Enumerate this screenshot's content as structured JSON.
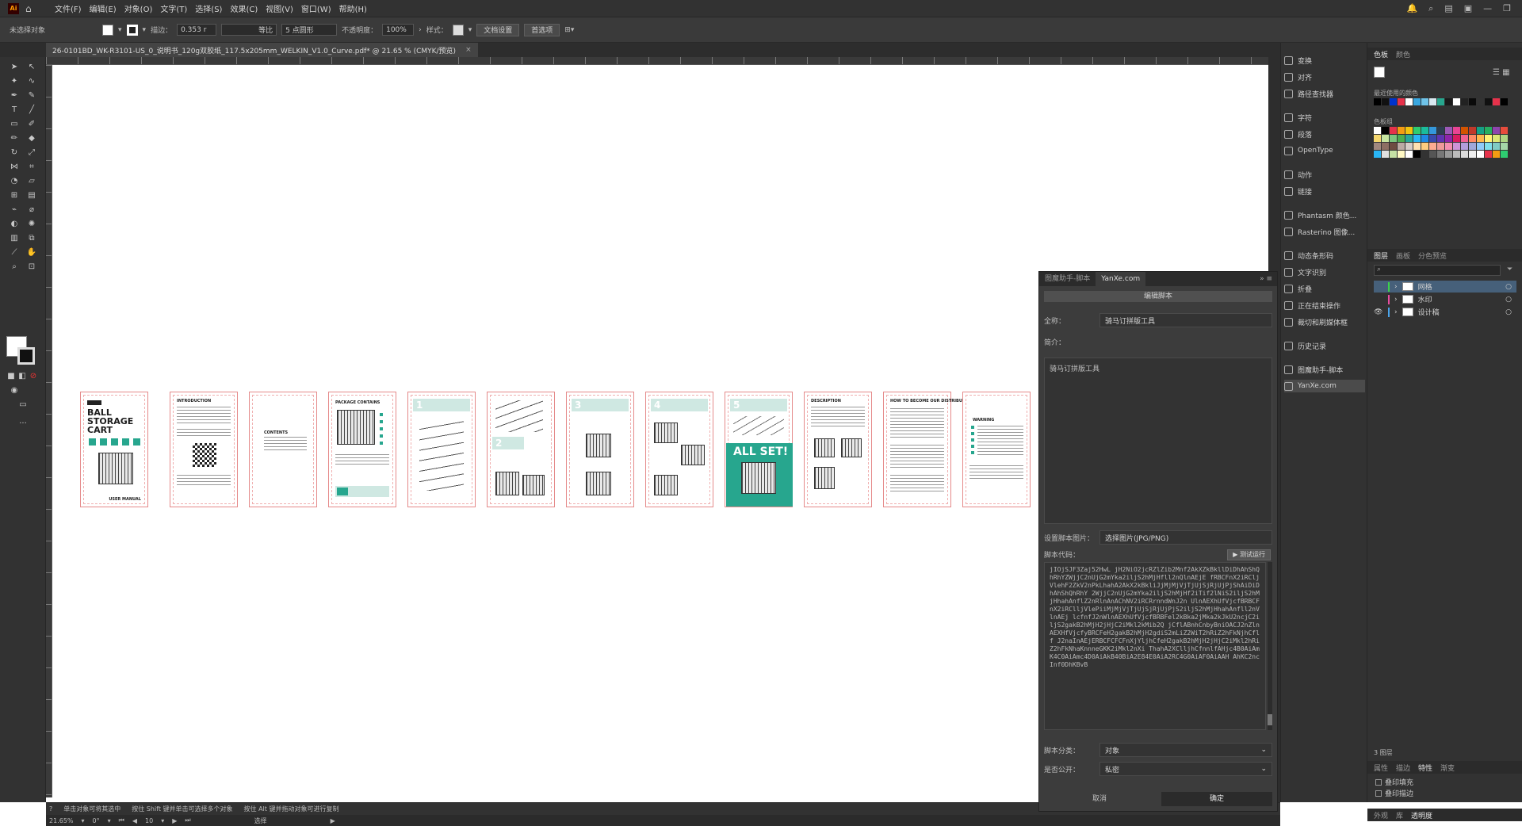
{
  "app": {
    "logo_text": "Ai"
  },
  "menubar": {
    "items": [
      "文件(F)",
      "编辑(E)",
      "对象(O)",
      "文字(T)",
      "选择(S)",
      "效果(C)",
      "视图(V)",
      "窗口(W)",
      "帮助(H)"
    ]
  },
  "control_bar": {
    "no_selection": "未选择对象",
    "stroke_label": "描边：",
    "stroke_value": "0.353 r",
    "stroke_style": "等比",
    "brush": "5 点圆形",
    "opacity_label": "不透明度：",
    "opacity_value": "100%",
    "style_label": "样式：",
    "doc_setup": "文档设置",
    "preferences": "首选项"
  },
  "document_tab": {
    "title": "26-0101BD_WK-R3101-US_0_说明书_120g双胶纸_117.5x205mm_WELKIN_V1.0_Curve.pdf* @ 21.65 % (CMYK/预览)"
  },
  "artboards": [
    {
      "title_line1": "BALL",
      "title_line2": "STORAGE",
      "title_line3": "CART",
      "footer": "USER MANUAL"
    },
    {
      "title": "INTRODUCTION"
    },
    {
      "title": "CONTENTS"
    },
    {
      "title": "PACKAGE CONTAINS"
    },
    {
      "step": "1"
    },
    {
      "step": "2"
    },
    {
      "step": "3"
    },
    {
      "step": "4"
    },
    {
      "step": "5",
      "banner": "ALL SET!"
    },
    {
      "title": "DESCRIPTION"
    },
    {
      "title": "HOW TO BECOME OUR DISTRIBUTOR"
    },
    {
      "title": "WARNING"
    }
  ],
  "status_bar": {
    "hint1": "单击对象可将其选中",
    "hint2": "按住 Shift 键并单击可选择多个对象",
    "hint3": "按住 Alt 键并拖动对象可进行复制",
    "zoom": "21.65%",
    "rotation": "0°",
    "artboard_num": "10",
    "mode": "选择"
  },
  "dialog": {
    "tab1": "图魔助手-脚本",
    "tab2": "YanXe.com",
    "header": "编辑脚本",
    "full_name_label": "全称：",
    "full_name_value": "骑马订拼版工具",
    "intro_label": "简介：",
    "intro_value": "骑马订拼版工具",
    "image_label": "设置脚本图片：",
    "image_value": "选择图片(JPG/PNG)",
    "code_label": "脚本代码：",
    "run_button": "▶ 测试运行",
    "code_text": "jIOjSJF3Zaj52HwL jH2NiO2jcRZlZib2Mnf2AkXZkBkllDiDhAhShQhRhYZWjjC2nUjG2mYka2iljS2hMjHfll2nQlnAEjE fRBCFnX2iRCljVlehF2ZkV2nPkLhahA2AkX2kBkliJjMjMjVjTjUjSjRjUjPjShAiDiDhAhShQhRhY 2WjjC2nUjG2mYka2iljS2hMjHf2iTif2lNiS2iljS2hMjHhahAnflZ2nRlnAnAChNV2iRCRrnndWnJ2n UlnAEXhUfVjcfBRBCFnX2iRClljVlePiiMjMjVjTjUjSjRjUjPjS2iljS2hMjHhahAnfll2nVlnAEj lcfnfJ2nWlnAEXhUfVjcfBRBFel2kBka2jMka2kJkU2ncjC2iljS2gakB2hMjH2jHjC2iMkl2kMib2Q jCflABnhCnbyBniOACJ2nZlnAEXHfVjcfyBRCFeH2gakB2hMjH2gdiS2mLiZ2WiT2hRiZ2hFkNjhCflf J2naInAEjERBCFCFCFnXjYljhCfeH2gakB2hMjH2jHjC2iMkl2hRiZ2hFkNhaKnnneGKK2iMkl2nXi ThahA2XClljhCfnnlfAHjc4B0AiAmK4C0AiAmc4D0AiAkB40BiA2E84E0AiA2RC4G0AiAF0AiAAH AhKC2ncInf0DhKBvB",
    "category_label": "脚本分类：",
    "category_value": "对象",
    "public_label": "是否公开：",
    "public_value": "私密",
    "cancel": "取消",
    "ok": "确定"
  },
  "panel_list": {
    "items": [
      "变换",
      "对齐",
      "路径查找器",
      "字符",
      "段落",
      "OpenType",
      "动作",
      "链接",
      "Phantasm 颜色...",
      "Rasterino 图像...",
      "动态条形码",
      "文字识别",
      "折叠",
      "正在结束操作",
      "裁切和刷媒体框",
      "历史记录",
      "图魔助手-脚本",
      "YanXe.com"
    ]
  },
  "right_panel": {
    "swatch_tabs": [
      "色板",
      "颜色"
    ],
    "recent_colors_label": "最近使用的颜色",
    "swatch_library_label": "色板组",
    "layer_tabs": [
      "图层",
      "画板",
      "分色预览"
    ],
    "layers": [
      "网格",
      "水印",
      "设计稿"
    ],
    "layer_count": "3 图层",
    "attr_tabs": [
      "属性",
      "描边",
      "特性",
      "渐变"
    ],
    "overprint_fill": "叠印填充",
    "overprint_stroke": "叠印描边",
    "bottom_tabs": [
      "外观",
      "库",
      "透明度"
    ]
  },
  "colors": {
    "teal": "#27a68e",
    "artboard_border": "#e58a8a",
    "ui_dark": "#323232"
  }
}
